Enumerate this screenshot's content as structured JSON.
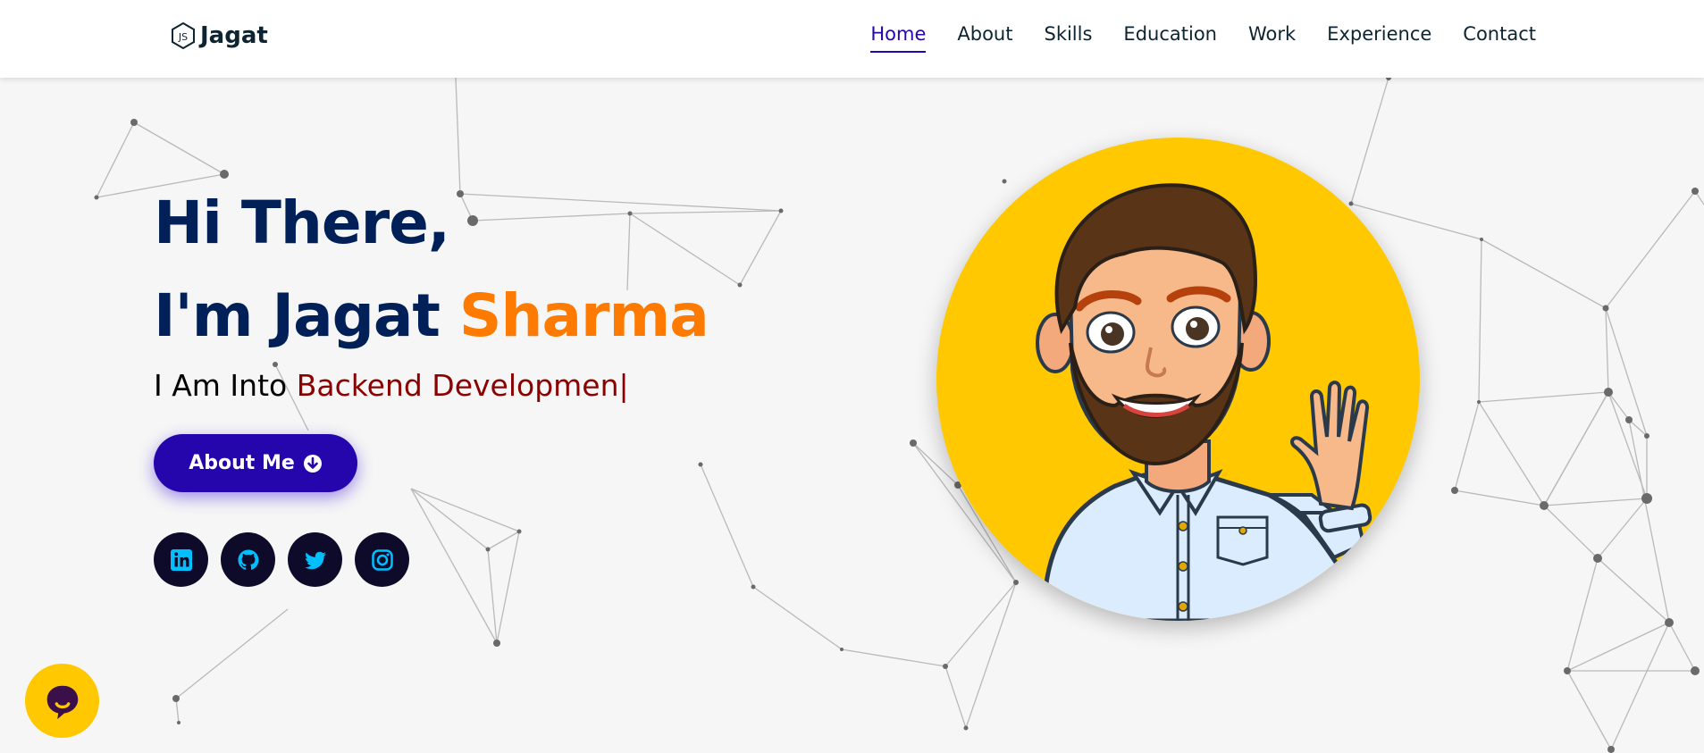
{
  "header": {
    "logo_text": "Jagat",
    "logo_icon": "nodejs-icon",
    "nav": [
      {
        "label": "Home",
        "active": true
      },
      {
        "label": "About",
        "active": false
      },
      {
        "label": "Skills",
        "active": false
      },
      {
        "label": "Education",
        "active": false
      },
      {
        "label": "Work",
        "active": false
      },
      {
        "label": "Experience",
        "active": false
      },
      {
        "label": "Contact",
        "active": false
      }
    ]
  },
  "hero": {
    "greeting": "Hi There,",
    "intro_prefix": "I'm Jagat ",
    "intro_highlight": "Sharma",
    "subtitle_prefix": "I Am Into ",
    "subtitle_typed": "Backend Developmen",
    "caret": "|",
    "button_label": "About Me",
    "button_icon": "arrow-down-circle-icon"
  },
  "socials": [
    {
      "name": "linkedin-icon"
    },
    {
      "name": "github-icon"
    },
    {
      "name": "twitter-icon"
    },
    {
      "name": "instagram-icon"
    }
  ],
  "avatar": {
    "icon": "waving-cartoon-avatar"
  },
  "chat": {
    "icon": "chat-bubble-icon"
  },
  "colors": {
    "accent": "#2506ad",
    "highlight": "#ff7a00",
    "title": "#002057",
    "typed": "#8b0000",
    "avatar_bg": "#ffc800",
    "social_bg": "#0e0a2a",
    "social_icon": "#00bfff"
  }
}
